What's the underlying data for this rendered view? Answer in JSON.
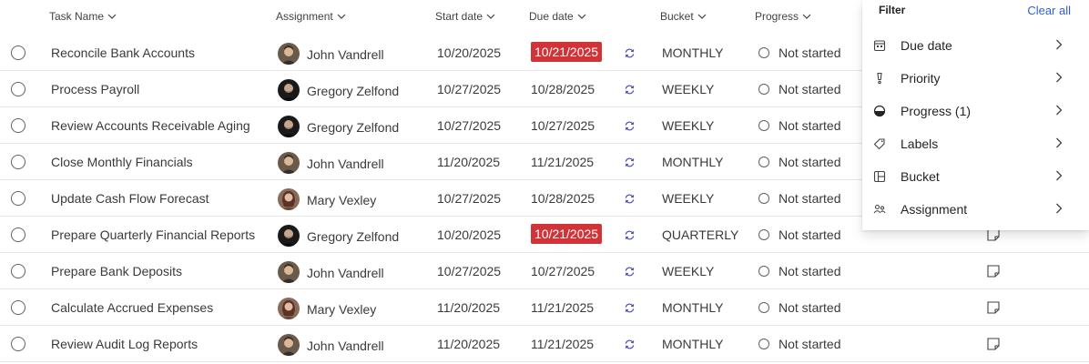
{
  "header": {
    "task_name": "Task Name",
    "assignment": "Assignment",
    "start_date": "Start date",
    "due_date": "Due date",
    "bucket": "Bucket",
    "progress": "Progress"
  },
  "rows": [
    {
      "task": "Reconcile Bank Accounts",
      "person": "John Vandrell",
      "avatar": "avatar-john",
      "start": "10/20/2025",
      "due": "10/21/2025",
      "overdue": true,
      "bucket": "MONTHLY",
      "progress": "Not started"
    },
    {
      "task": "Process Payroll",
      "person": "Gregory Zelfond",
      "avatar": "avatar-gregory",
      "start": "10/27/2025",
      "due": "10/28/2025",
      "overdue": false,
      "bucket": "WEEKLY",
      "progress": "Not started"
    },
    {
      "task": "Review Accounts Receivable Aging",
      "person": "Gregory Zelfond",
      "avatar": "avatar-gregory",
      "start": "10/27/2025",
      "due": "10/27/2025",
      "overdue": false,
      "bucket": "WEEKLY",
      "progress": "Not started"
    },
    {
      "task": "Close Monthly Financials",
      "person": "John Vandrell",
      "avatar": "avatar-john",
      "start": "11/20/2025",
      "due": "11/21/2025",
      "overdue": false,
      "bucket": "MONTHLY",
      "progress": "Not started"
    },
    {
      "task": "Update Cash Flow Forecast",
      "person": "Mary Vexley",
      "avatar": "avatar-mary",
      "start": "10/27/2025",
      "due": "10/28/2025",
      "overdue": false,
      "bucket": "WEEKLY",
      "progress": "Not started"
    },
    {
      "task": "Prepare Quarterly Financial Reports",
      "person": "Gregory Zelfond",
      "avatar": "avatar-gregory",
      "start": "10/20/2025",
      "due": "10/21/2025",
      "overdue": true,
      "bucket": "QUARTERLY",
      "progress": "Not started"
    },
    {
      "task": "Prepare Bank Deposits",
      "person": "John Vandrell",
      "avatar": "avatar-john",
      "start": "10/27/2025",
      "due": "10/27/2025",
      "overdue": false,
      "bucket": "WEEKLY",
      "progress": "Not started"
    },
    {
      "task": "Calculate Accrued Expenses",
      "person": "Mary Vexley",
      "avatar": "avatar-mary",
      "start": "11/20/2025",
      "due": "11/21/2025",
      "overdue": false,
      "bucket": "MONTHLY",
      "progress": "Not started"
    },
    {
      "task": "Review Audit Log Reports",
      "person": "John Vandrell",
      "avatar": "avatar-john",
      "start": "11/20/2025",
      "due": "11/21/2025",
      "overdue": false,
      "bucket": "MONTHLY",
      "progress": "Not started"
    }
  ],
  "filter": {
    "title": "Filter",
    "clear_all": "Clear all",
    "items": [
      {
        "label": "Due date",
        "icon": "calendar-icon"
      },
      {
        "label": "Priority",
        "icon": "priority-icon"
      },
      {
        "label": "Progress (1)",
        "icon": "progress-half-icon"
      },
      {
        "label": "Labels",
        "icon": "tag-icon"
      },
      {
        "label": "Bucket",
        "icon": "bucket-icon"
      },
      {
        "label": "Assignment",
        "icon": "people-icon"
      }
    ]
  },
  "colors": {
    "overdue": "#d13438",
    "link": "#2f5fd0",
    "recurrence": "#4f52b2"
  }
}
